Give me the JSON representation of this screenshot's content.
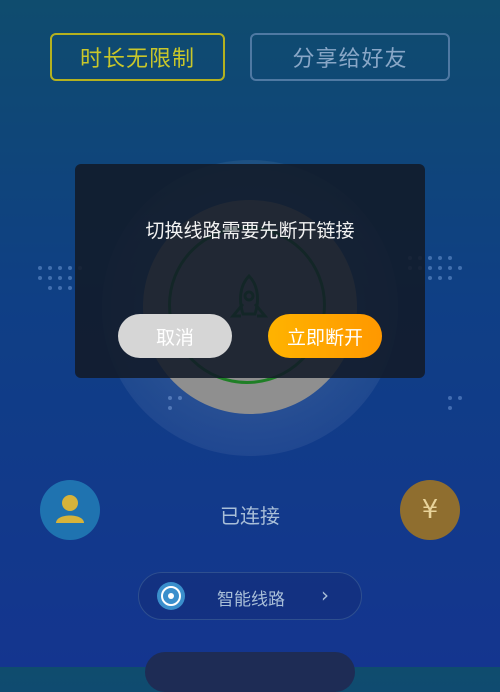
{
  "top": {
    "unlimited_label": "时长无限制",
    "share_label": "分享给好友"
  },
  "dialog": {
    "message": "切换线路需要先断开链接",
    "cancel_label": "取消",
    "disconnect_label": "立即断开"
  },
  "status": {
    "text": "已连接"
  },
  "coin": {
    "symbol": "¥"
  },
  "route": {
    "label": "智能线路",
    "chevron": "›"
  },
  "icons": [
    "user-icon",
    "yen-coin-icon",
    "rocket-icon",
    "route-icon",
    "chevron-right-icon"
  ],
  "colors": {
    "gold": "#c9c72a",
    "orange": "#ff9800",
    "green_ring": "#1f7f26"
  }
}
